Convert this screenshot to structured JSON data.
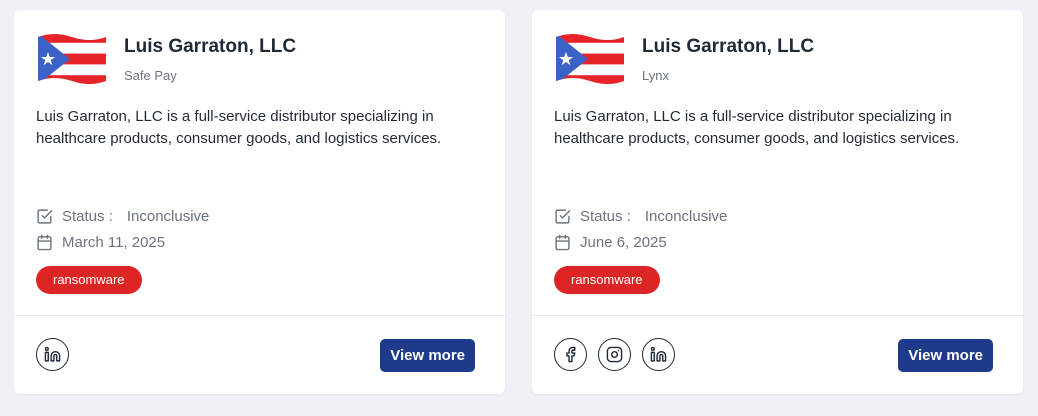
{
  "cards": [
    {
      "flag_icon": "puerto-rico-flag-icon",
      "title": "Luis Garraton, LLC",
      "subtitle": "Safe Pay",
      "description": "Luis Garraton, LLC is a full-service distributor specializing in healthcare products, consumer goods, and logistics services.",
      "status_label": "Status :",
      "status_value": "Inconclusive",
      "date": "March 11, 2025",
      "tag": "ransomware",
      "social_icons": [
        "linkedin-icon"
      ],
      "button_label": "View more"
    },
    {
      "flag_icon": "puerto-rico-flag-icon",
      "title": "Luis Garraton, LLC",
      "subtitle": "Lynx",
      "description": "Luis Garraton, LLC is a full-service distributor specializing in healthcare products, consumer goods, and logistics services.",
      "status_label": "Status :",
      "status_value": "Inconclusive",
      "date": "June 6, 2025",
      "tag": "ransomware",
      "social_icons": [
        "facebook-icon",
        "instagram-icon",
        "linkedin-icon"
      ],
      "button_label": "View more"
    }
  ],
  "colors": {
    "tag_background": "#dc2626",
    "button_background": "#1e3a8a",
    "page_background": "#eef1f6"
  }
}
